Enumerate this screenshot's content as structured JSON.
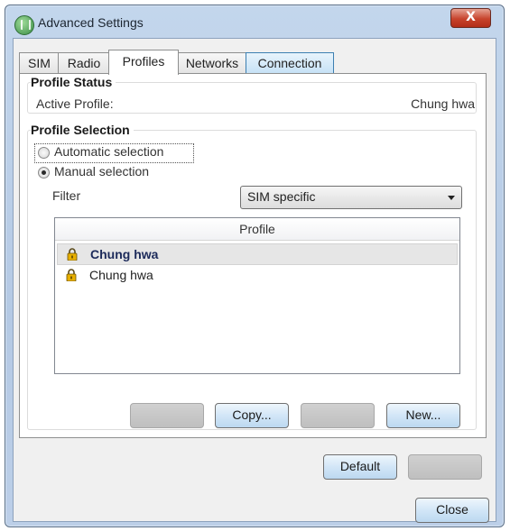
{
  "window": {
    "title": "Advanced Settings",
    "close_glyph": "X"
  },
  "tabs": [
    {
      "label": "SIM"
    },
    {
      "label": "Radio"
    },
    {
      "label": "Profiles"
    },
    {
      "label": "Networks"
    },
    {
      "label": "Connection"
    }
  ],
  "active_tab": "Profiles",
  "profile_status": {
    "title": "Profile Status",
    "active_label": "Active Profile:",
    "active_value": "Chung hwa"
  },
  "profile_selection": {
    "title": "Profile Selection",
    "automatic_label": "Automatic selection",
    "manual_label": "Manual selection",
    "selected_mode": "manual",
    "filter_label": "Filter",
    "filter_value": "SIM specific"
  },
  "profile_list": {
    "column_header": "Profile",
    "rows": [
      {
        "name": "Chung hwa",
        "icon": "lock-icon",
        "selected": true
      },
      {
        "name": "Chung hwa",
        "icon": "lock-icon",
        "selected": false
      }
    ]
  },
  "list_buttons": {
    "copy": "Copy...",
    "new": "New..."
  },
  "bottom_buttons": {
    "default": "Default",
    "close": "Close"
  },
  "colors": {
    "titlebar": "#bcd0e8",
    "close_button": "#c7432c",
    "selected_row": "#e6e6e6"
  }
}
